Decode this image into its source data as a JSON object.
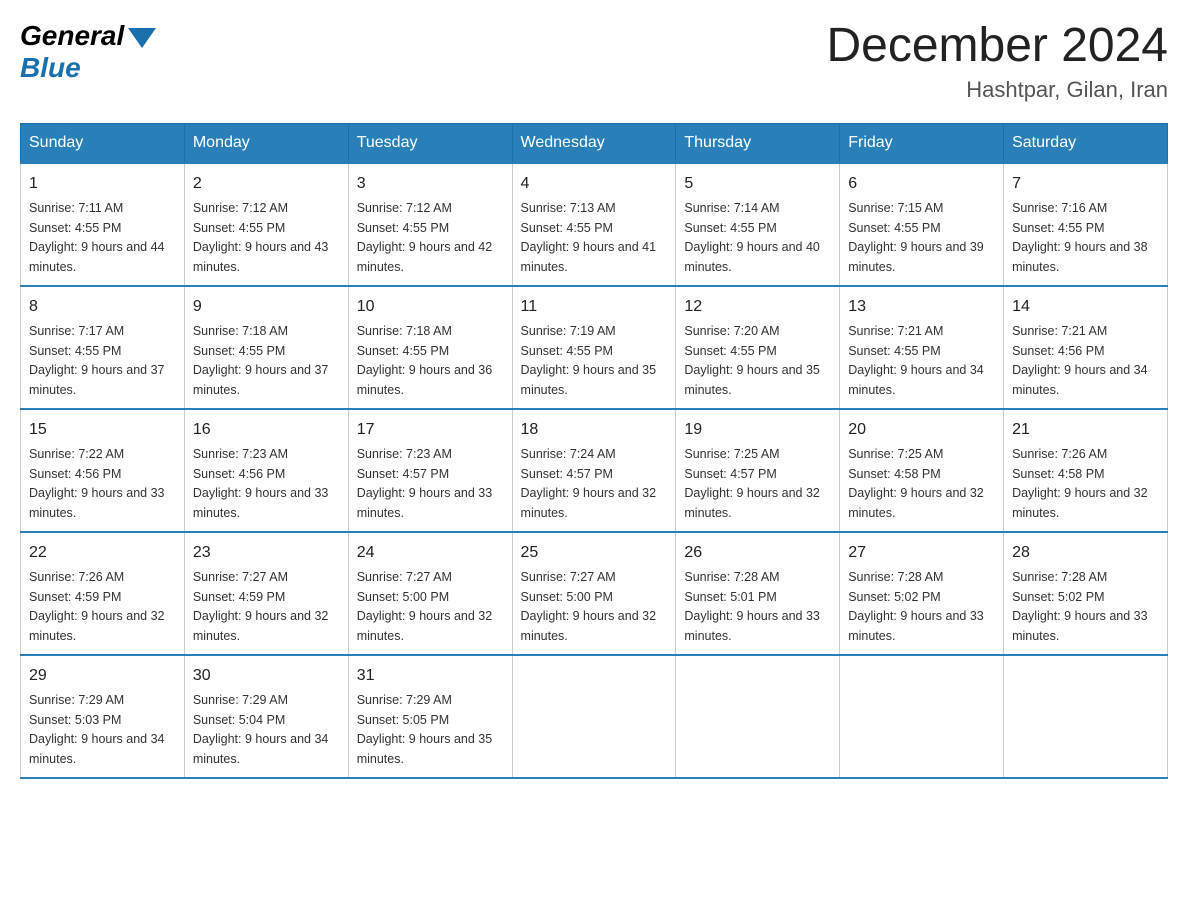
{
  "header": {
    "logo_general": "General",
    "logo_blue": "Blue",
    "title": "December 2024",
    "subtitle": "Hashtpar, Gilan, Iran"
  },
  "days_of_week": [
    "Sunday",
    "Monday",
    "Tuesday",
    "Wednesday",
    "Thursday",
    "Friday",
    "Saturday"
  ],
  "weeks": [
    [
      {
        "day": "1",
        "sunrise": "7:11 AM",
        "sunset": "4:55 PM",
        "daylight": "9 hours and 44 minutes."
      },
      {
        "day": "2",
        "sunrise": "7:12 AM",
        "sunset": "4:55 PM",
        "daylight": "9 hours and 43 minutes."
      },
      {
        "day": "3",
        "sunrise": "7:12 AM",
        "sunset": "4:55 PM",
        "daylight": "9 hours and 42 minutes."
      },
      {
        "day": "4",
        "sunrise": "7:13 AM",
        "sunset": "4:55 PM",
        "daylight": "9 hours and 41 minutes."
      },
      {
        "day": "5",
        "sunrise": "7:14 AM",
        "sunset": "4:55 PM",
        "daylight": "9 hours and 40 minutes."
      },
      {
        "day": "6",
        "sunrise": "7:15 AM",
        "sunset": "4:55 PM",
        "daylight": "9 hours and 39 minutes."
      },
      {
        "day": "7",
        "sunrise": "7:16 AM",
        "sunset": "4:55 PM",
        "daylight": "9 hours and 38 minutes."
      }
    ],
    [
      {
        "day": "8",
        "sunrise": "7:17 AM",
        "sunset": "4:55 PM",
        "daylight": "9 hours and 37 minutes."
      },
      {
        "day": "9",
        "sunrise": "7:18 AM",
        "sunset": "4:55 PM",
        "daylight": "9 hours and 37 minutes."
      },
      {
        "day": "10",
        "sunrise": "7:18 AM",
        "sunset": "4:55 PM",
        "daylight": "9 hours and 36 minutes."
      },
      {
        "day": "11",
        "sunrise": "7:19 AM",
        "sunset": "4:55 PM",
        "daylight": "9 hours and 35 minutes."
      },
      {
        "day": "12",
        "sunrise": "7:20 AM",
        "sunset": "4:55 PM",
        "daylight": "9 hours and 35 minutes."
      },
      {
        "day": "13",
        "sunrise": "7:21 AM",
        "sunset": "4:55 PM",
        "daylight": "9 hours and 34 minutes."
      },
      {
        "day": "14",
        "sunrise": "7:21 AM",
        "sunset": "4:56 PM",
        "daylight": "9 hours and 34 minutes."
      }
    ],
    [
      {
        "day": "15",
        "sunrise": "7:22 AM",
        "sunset": "4:56 PM",
        "daylight": "9 hours and 33 minutes."
      },
      {
        "day": "16",
        "sunrise": "7:23 AM",
        "sunset": "4:56 PM",
        "daylight": "9 hours and 33 minutes."
      },
      {
        "day": "17",
        "sunrise": "7:23 AM",
        "sunset": "4:57 PM",
        "daylight": "9 hours and 33 minutes."
      },
      {
        "day": "18",
        "sunrise": "7:24 AM",
        "sunset": "4:57 PM",
        "daylight": "9 hours and 32 minutes."
      },
      {
        "day": "19",
        "sunrise": "7:25 AM",
        "sunset": "4:57 PM",
        "daylight": "9 hours and 32 minutes."
      },
      {
        "day": "20",
        "sunrise": "7:25 AM",
        "sunset": "4:58 PM",
        "daylight": "9 hours and 32 minutes."
      },
      {
        "day": "21",
        "sunrise": "7:26 AM",
        "sunset": "4:58 PM",
        "daylight": "9 hours and 32 minutes."
      }
    ],
    [
      {
        "day": "22",
        "sunrise": "7:26 AM",
        "sunset": "4:59 PM",
        "daylight": "9 hours and 32 minutes."
      },
      {
        "day": "23",
        "sunrise": "7:27 AM",
        "sunset": "4:59 PM",
        "daylight": "9 hours and 32 minutes."
      },
      {
        "day": "24",
        "sunrise": "7:27 AM",
        "sunset": "5:00 PM",
        "daylight": "9 hours and 32 minutes."
      },
      {
        "day": "25",
        "sunrise": "7:27 AM",
        "sunset": "5:00 PM",
        "daylight": "9 hours and 32 minutes."
      },
      {
        "day": "26",
        "sunrise": "7:28 AM",
        "sunset": "5:01 PM",
        "daylight": "9 hours and 33 minutes."
      },
      {
        "day": "27",
        "sunrise": "7:28 AM",
        "sunset": "5:02 PM",
        "daylight": "9 hours and 33 minutes."
      },
      {
        "day": "28",
        "sunrise": "7:28 AM",
        "sunset": "5:02 PM",
        "daylight": "9 hours and 33 minutes."
      }
    ],
    [
      {
        "day": "29",
        "sunrise": "7:29 AM",
        "sunset": "5:03 PM",
        "daylight": "9 hours and 34 minutes."
      },
      {
        "day": "30",
        "sunrise": "7:29 AM",
        "sunset": "5:04 PM",
        "daylight": "9 hours and 34 minutes."
      },
      {
        "day": "31",
        "sunrise": "7:29 AM",
        "sunset": "5:05 PM",
        "daylight": "9 hours and 35 minutes."
      },
      null,
      null,
      null,
      null
    ]
  ],
  "labels": {
    "sunrise": "Sunrise:",
    "sunset": "Sunset:",
    "daylight": "Daylight:"
  }
}
